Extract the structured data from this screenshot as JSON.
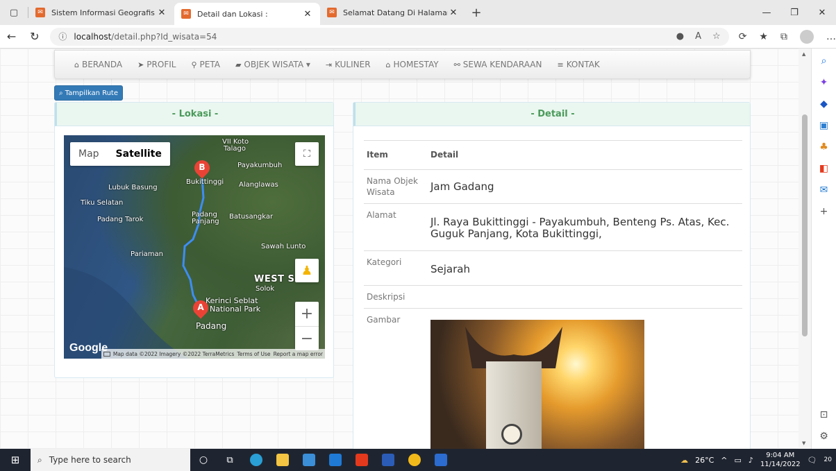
{
  "browser": {
    "tabs": [
      {
        "title": "Sistem Informasi Geografis",
        "active": false
      },
      {
        "title": "Detail dan Lokasi :",
        "active": true
      },
      {
        "title": "Selamat Datang Di Halaman Adr",
        "active": false
      }
    ],
    "url_host": "localhost",
    "url_path": "/detail.php?Id_wisata=54"
  },
  "nav": {
    "items": [
      {
        "icon": "home-icon",
        "label": "BERANDA"
      },
      {
        "icon": "send-icon",
        "label": "PROFIL"
      },
      {
        "icon": "map-marker-icon",
        "label": "PETA"
      },
      {
        "icon": "book-icon",
        "label": "OBJEK WISATA ▾"
      },
      {
        "icon": "login-icon",
        "label": "KULINER"
      },
      {
        "icon": "home-outline-icon",
        "label": "HOMESTAY"
      },
      {
        "icon": "bicycle-icon",
        "label": "SEWA KENDARAAN"
      },
      {
        "icon": "list-icon",
        "label": "KONTAK"
      }
    ]
  },
  "rute_button": "Tampilkan Rute",
  "lokasi": {
    "title": "- Lokasi -",
    "map": {
      "type_map": "Map",
      "type_satellite": "Satellite",
      "labels": {
        "vii_koto": "VII Koto",
        "talago": "Talago",
        "payakumbuh": "Payakumbuh",
        "bukittinggi": "Bukittinggi",
        "lubuk_basung": "Lubuk Basung",
        "alanglawas": "Alanglawas",
        "tiku_selatan": "Tiku Selatan",
        "padang_tarok": "Padang Tarok",
        "padang_panjang": "Padang Panjang",
        "batusangkar": "Batusangkar",
        "pariaman": "Pariaman",
        "sawah_lunto": "Sawah Lunto",
        "west_s": "WEST S",
        "solok": "Solok",
        "kerinci": "Kerinci Seblat",
        "national_park": "National Park",
        "padang": "Padang"
      },
      "marker_a": "A",
      "marker_b": "B",
      "google": "Google",
      "attribution": "Map data ©2022 Imagery ©2022 TerraMetrics",
      "terms": "Terms of Use",
      "report": "Report a map error"
    }
  },
  "detail": {
    "title": "- Detail -",
    "header": {
      "item": "Item",
      "detail": "Detail"
    },
    "rows": [
      {
        "key": "Nama Objek Wisata",
        "value": "Jam Gadang"
      },
      {
        "key": "Alamat",
        "value": "Jl. Raya Bukittinggi - Payakumbuh, Benteng Ps. Atas, Kec. Guguk Panjang, Kota Bukittinggi,"
      },
      {
        "key": "Kategori",
        "value": "Sejarah"
      },
      {
        "key": "Deskripsi",
        "value": ""
      },
      {
        "key": "Gambar",
        "value": ""
      }
    ]
  },
  "taskbar": {
    "search_placeholder": "Type here to search",
    "weather": "26°C",
    "time": "9:04 AM",
    "date": "11/14/2022",
    "notif_count": "20"
  }
}
